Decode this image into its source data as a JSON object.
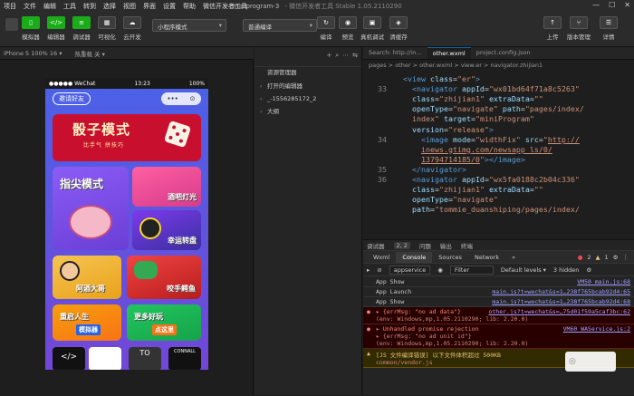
{
  "menu": {
    "items": [
      "项目",
      "文件",
      "编辑",
      "工具",
      "转到",
      "选择",
      "视图",
      "界面",
      "设置",
      "帮助",
      "微信开发者工具"
    ],
    "title": "miniprogram-3",
    "subtitle": "- 微信开发者工具 Stable 1.05.2110290"
  },
  "toolbar": {
    "left_buttons": [
      "模拟器",
      "编辑器",
      "调试器",
      "可视化",
      "云开发"
    ],
    "mode_select": "小程序模式",
    "compile_select": "普通编译",
    "mid_buttons": [
      "编译",
      "预览",
      "真机调试",
      "清缓存"
    ],
    "right_buttons": [
      "上传",
      "版本管理",
      "详情"
    ]
  },
  "simulator": {
    "device": "iPhone 5 100% 16 ▾",
    "hotreload": "热重载 关 ▾",
    "status_carrier": "●●●●● WeChat",
    "status_time": "13:23",
    "status_battery": "100%",
    "invite_label": "邀请好友",
    "capsule": [
      "•••",
      "⊙"
    ],
    "banner_title": "骰子模式",
    "banner_sub": "比手气 拼技巧",
    "cards": [
      "指尖模式",
      "酒吧灯光",
      "幸运转盘",
      "阿酒大哥",
      "咬手鳄鱼",
      "重启人生",
      "模拟器",
      "更多好玩",
      "点这里"
    ],
    "mini_tiles": [
      "</>",
      "",
      "TO",
      "CONNALL"
    ]
  },
  "resource": {
    "header": "资源管理器",
    "rows": [
      "打开的编辑器",
      "_-1556285172_2",
      "大纲"
    ]
  },
  "editor": {
    "tabs": [
      "Search: http://in...",
      "other.wxml",
      "project.config.json"
    ],
    "crumbs": "pages > other > other.wxml > view.er > navigator.zhijian1",
    "lines": [
      {
        "n": "",
        "html": "<span class='tg'>&lt;view</span> <span class='at'>class</span>=<span class='st'>\"er\"</span><span class='tg'>&gt;</span>"
      },
      {
        "n": "33",
        "html": "  <span class='tg'>&lt;navigator</span> <span class='at'>appId</span>=<span class='st'>\"wx01bd64f71a8c5263\"</span>"
      },
      {
        "n": "",
        "html": "  <span class='at'>class</span>=<span class='st'>\"zhijian1\"</span> <span class='at'>extraData</span>=<span class='st'>\"\"</span>"
      },
      {
        "n": "",
        "html": "  <span class='at'>openType</span>=<span class='st'>\"navigate\"</span> <span class='at'>path</span>=<span class='st'>\"pages/index/</span>"
      },
      {
        "n": "",
        "html": "  <span class='st'>index\"</span> <span class='at'>target</span>=<span class='st'>\"miniProgram\"</span>"
      },
      {
        "n": "",
        "html": "  <span class='at'>version</span>=<span class='st'>\"release\"</span><span class='tg'>&gt;</span>"
      },
      {
        "n": "34",
        "html": "    <span class='tg'>&lt;image</span> <span class='at'>mode</span>=<span class='st'>\"widthFix\"</span> <span class='at'>src</span>=<span class='st'>\"</span><span class='ur'>http://</span>"
      },
      {
        "n": "",
        "html": "    <span class='ur'>inews.gtimg.com/newsapp_ls/0/</span>"
      },
      {
        "n": "",
        "html": "    <span class='ur'>13794714185/0</span><span class='st'>\"</span><span class='tg'>&gt;&lt;/image&gt;</span>"
      },
      {
        "n": "35",
        "html": "  <span class='tg'>&lt;/navigator&gt;</span>"
      },
      {
        "n": "36",
        "html": "  <span class='tg'>&lt;navigator</span> <span class='at'>appId</span>=<span class='st'>\"wx5fa0188c2b04c336\"</span>"
      },
      {
        "n": "",
        "html": "  <span class='at'>class</span>=<span class='st'>\"zhijian1\"</span> <span class='at'>extraData</span>=<span class='st'>\"\"</span>"
      },
      {
        "n": "",
        "html": "  <span class='at'>openType</span>=<span class='st'>\"navigate\"</span>"
      },
      {
        "n": "",
        "html": "  <span class='at'>path</span>=<span class='st'>\"tommie_duanshiping/pages/index/</span>"
      }
    ]
  },
  "devtools": {
    "top_tabs": [
      "调试器",
      "2, 2",
      "问题",
      "输出",
      "终端"
    ],
    "tabs": [
      "Wxml",
      "Console",
      "Sources",
      "Network"
    ],
    "counts": {
      "errors": "2",
      "warnings": "1"
    },
    "context": "appservice",
    "filter_placeholder": "Filter",
    "levels": "Default levels ▾",
    "hidden": "3 hidden",
    "logs": [
      {
        "type": "info",
        "text": "App Show",
        "src": "VM50 main.js:68"
      },
      {
        "type": "info",
        "text": "App Launch",
        "src": "main.js?t=wechat&s=1…238f765bcab92d4:65"
      },
      {
        "type": "info",
        "text": "App Show",
        "src": "main.js?t=wechat&s=1…238f765bcab92d4:68"
      },
      {
        "type": "err",
        "text": "▸ {errMsg: \"no ad data\"}",
        "sub": "(env: Windows,mp,1.05.2110290; lib: 2.20.0)",
        "src": "other.js?t=wechat&s=…75d01f59a5caf3bc:62"
      },
      {
        "type": "err",
        "text": "▸ Unhandled promise rejection",
        "sub": "▸ {errMsg: \"no ad unit id\"}",
        "sub2": "(env: Windows,mp,1.05.2110290; lib: 2.20.0)",
        "src": "VM60 WAService.js:2"
      },
      {
        "type": "warn",
        "text": "[JS 文件编译错误] 以下文件体积超过 500KB",
        "sub": "common/vendor.js",
        "src": ""
      }
    ]
  }
}
